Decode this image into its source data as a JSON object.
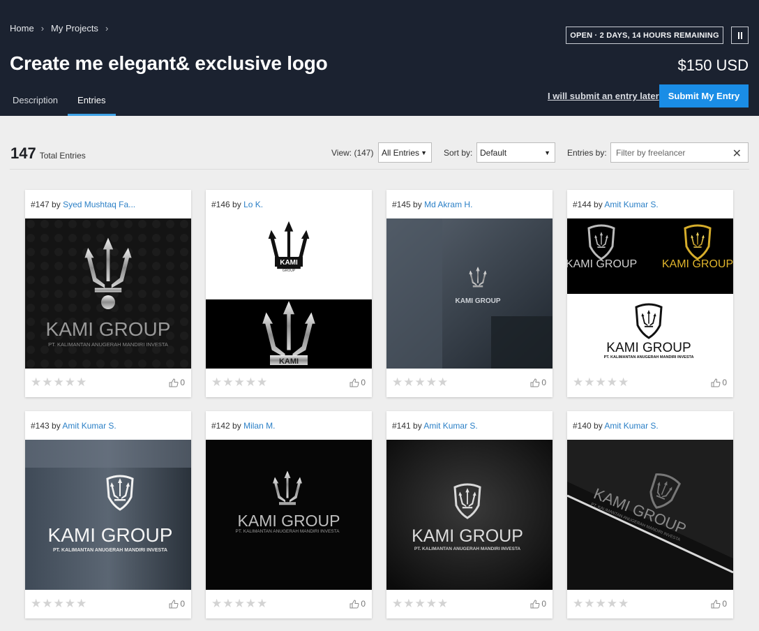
{
  "breadcrumb": {
    "items": [
      "Home",
      "My Projects"
    ],
    "separator": "›"
  },
  "project": {
    "title": "Create me elegant& exclusive logo",
    "status": "OPEN · 2 DAYS, 14 HOURS REMAINING",
    "price": "$150 USD"
  },
  "tabs": [
    "Description",
    "Entries"
  ],
  "actions": {
    "later": "I will submit an entry later",
    "submit": "Submit My Entry"
  },
  "toolbar": {
    "total": "147",
    "total_label": "Total Entries",
    "view_label": "View: (147)",
    "view_value": "All Entries",
    "sort_label": "Sort by:",
    "sort_value": "Default",
    "entries_by_label": "Entries by:",
    "filter_placeholder": "Filter by freelancer"
  },
  "entries": [
    {
      "num": "#147",
      "by": "by",
      "author": "Syed Mushtaq Fa...",
      "likes": "0"
    },
    {
      "num": "#146",
      "by": "by",
      "author": "Lo K.",
      "likes": "0"
    },
    {
      "num": "#145",
      "by": "by",
      "author": "Md Akram H.",
      "likes": "0"
    },
    {
      "num": "#144",
      "by": "by",
      "author": "Amit Kumar S.",
      "likes": "0"
    },
    {
      "num": "#143",
      "by": "by",
      "author": "Amit Kumar S.",
      "likes": "0"
    },
    {
      "num": "#142",
      "by": "by",
      "author": "Milan M.",
      "likes": "0"
    },
    {
      "num": "#141",
      "by": "by",
      "author": "Amit Kumar S.",
      "likes": "0"
    },
    {
      "num": "#140",
      "by": "by",
      "author": "Amit Kumar S.",
      "likes": "0"
    }
  ],
  "logo_text": {
    "brand": "KAMI GROUP",
    "sub": "PT. KALIMANTAN ANUGERAH MANDIRI INVESTA",
    "short": "KAMI",
    "group": "GROUP"
  },
  "colors": {
    "header_bg": "#1b2230",
    "accent": "#1a8de6",
    "link": "#2a7fc6",
    "tab_underline": "#3ea2e6"
  }
}
